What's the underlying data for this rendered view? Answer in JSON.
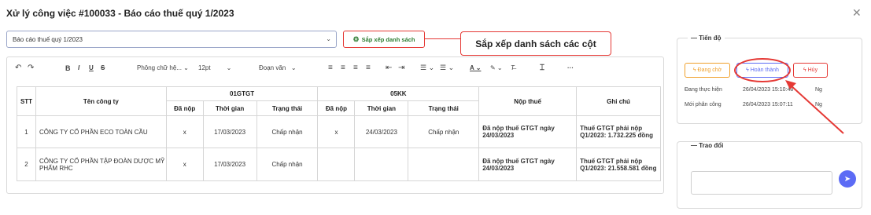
{
  "modal": {
    "title": "Xử lý công việc #100033 - Báo cáo thuế quý 1/2023"
  },
  "select": {
    "value": "Báo cáo thuế quý 1/2023"
  },
  "sort_button": {
    "label": "Sắp xếp danh sách"
  },
  "callout": {
    "text": "Sắp xếp danh sách các cột"
  },
  "toolbar": {
    "font": "Phông chữ hệ...",
    "size": "12pt",
    "style": "Đoạn văn",
    "more": "···"
  },
  "table": {
    "header": {
      "stt": "STT",
      "company": "Tên công ty",
      "group1": "01GTGT",
      "group2": "05KK",
      "paid": "Đã nộp",
      "time": "Thời gian",
      "status": "Trạng thái",
      "tax": "Nộp thuế",
      "note": "Ghi chú"
    },
    "rows": [
      {
        "stt": "1",
        "company": "CÔNG TY CỔ PHẦN ECO TOÀN CẦU",
        "g1_paid": "x",
        "g1_time": "17/03/2023",
        "g1_status": "Chấp nhận",
        "g2_paid": "x",
        "g2_time": "24/03/2023",
        "g2_status": "Chấp nhận",
        "tax": "Đã nộp thuế GTGT ngày 24/03/2023",
        "note": "Thuế GTGT phải nộp Q1/2023: 1.732.225 đồng"
      },
      {
        "stt": "2",
        "company": "CÔNG TY CỔ PHẦN TẬP ĐOÀN DƯỢC MỸ PHẨM RHC",
        "g1_paid": "x",
        "g1_time": "17/03/2023",
        "g1_status": "Chấp nhận",
        "g2_paid": "",
        "g2_time": "",
        "g2_status": "",
        "tax": "Đã nộp thuế GTGT ngày 24/03/2023",
        "note": "Thuế GTGT phải nộp Q1/2023: 21.558.581 đồng"
      }
    ]
  },
  "progress": {
    "legend": "Tiến độ",
    "buttons": {
      "pending": "Đang chờ",
      "done": "Hoàn thành",
      "cancel": "Hủy"
    },
    "rows": [
      {
        "label": "Đang thực hiện",
        "time": "26/04/2023 15:10:48",
        "user": "Ng"
      },
      {
        "label": "Mới phân công",
        "time": "26/04/2023 15:07:11",
        "user": "Ng"
      }
    ]
  },
  "discussion": {
    "legend": "Trao đổi"
  },
  "colors": {
    "accent": "#5c6bf5",
    "danger": "#e53935",
    "success": "#2e7d32",
    "warning": "#f0a02a"
  }
}
